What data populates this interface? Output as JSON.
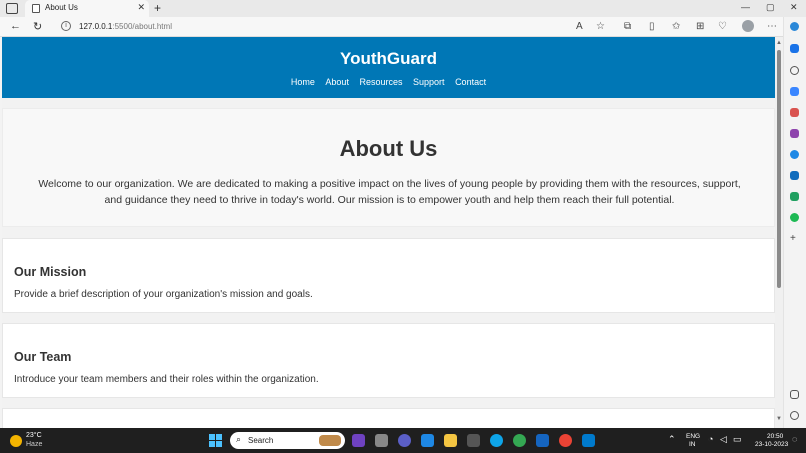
{
  "browser": {
    "tab_title": "About Us",
    "tab_close": "✕",
    "new_tab": "+",
    "url_host": "127.0.0.1",
    "url_rest": ":5500/about.html",
    "win_min": "—",
    "win_max": "▢",
    "win_close": "✕"
  },
  "site": {
    "brand": "YouthGuard",
    "nav": [
      "Home",
      "About",
      "Resources",
      "Support",
      "Contact"
    ]
  },
  "about": {
    "heading": "About Us",
    "text": "Welcome to our organization. We are dedicated to making a positive impact on the lives of young people by providing them with the resources, support, and guidance they need to thrive in today's world. Our mission is to empower youth and help them reach their full potential."
  },
  "sections": [
    {
      "heading": "Our Mission",
      "text": "Provide a brief description of your organization's mission and goals."
    },
    {
      "heading": "Our Team",
      "text": "Introduce your team members and their roles within the organization."
    }
  ],
  "taskbar": {
    "weather_temp": "23°C",
    "weather_desc": "Haze",
    "search_label": "Search",
    "lang_top": "ENG",
    "lang_bottom": "IN",
    "time": "20:50",
    "date": "23-10-2023"
  },
  "colors": {
    "header_bg": "#0077b6",
    "taskbar_bg": "#1f1f1f"
  }
}
